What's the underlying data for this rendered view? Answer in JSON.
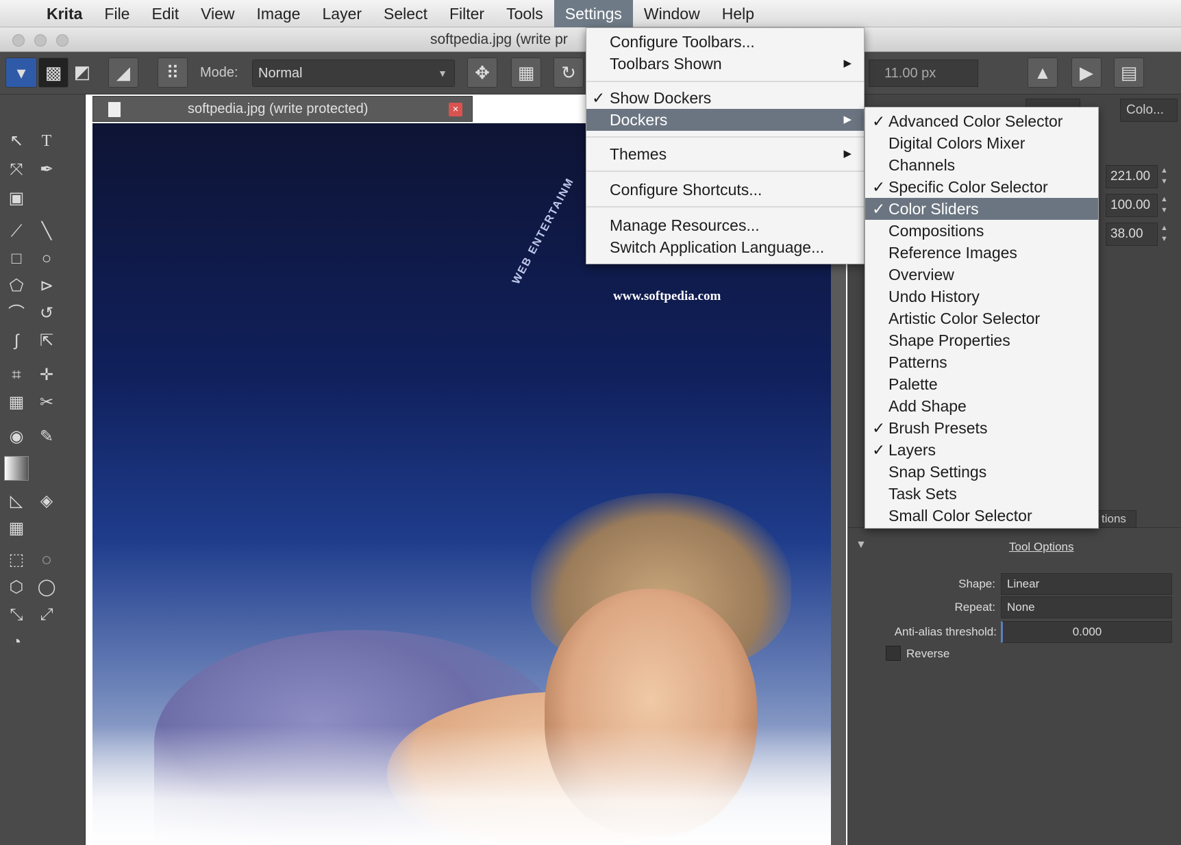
{
  "menubar": {
    "apple": "",
    "items": [
      "Krita",
      "File",
      "Edit",
      "View",
      "Image",
      "Layer",
      "Select",
      "Filter",
      "Tools",
      "Settings",
      "Window",
      "Help"
    ],
    "active": "Settings"
  },
  "window": {
    "title": "softpedia.jpg (write pr"
  },
  "toolbar": {
    "mode_label": "Mode:",
    "mode_value": "Normal",
    "size_value": "11.00 px"
  },
  "document_tab": {
    "label": "softpedia.jpg (write protected)",
    "close": "×"
  },
  "canvas": {
    "url_text": "www.softpedia.com",
    "arc_text": "WEB  ENTERTAINM"
  },
  "right_panel": {
    "tab_label": "Colo...",
    "spin_values": [
      "221.00",
      "100.00",
      "38.00"
    ]
  },
  "tool_options": {
    "tab_label": "tions",
    "title": "Tool Options",
    "shape_label": "Shape:",
    "shape_value": "Linear",
    "repeat_label": "Repeat:",
    "repeat_value": "None",
    "antialias_label": "Anti-alias threshold:",
    "antialias_value": "0.000",
    "reverse_label": "Reverse"
  },
  "settings_menu": {
    "items": [
      {
        "label": "Configure Toolbars...",
        "checked": false,
        "submenu": false
      },
      {
        "label": "Toolbars Shown",
        "checked": false,
        "submenu": true
      },
      {
        "label": "Show Dockers",
        "checked": true,
        "submenu": false
      },
      {
        "label": "Dockers",
        "checked": false,
        "submenu": true,
        "highlighted": true
      },
      {
        "label": "Themes",
        "checked": false,
        "submenu": true
      },
      {
        "label": "Configure Shortcuts...",
        "checked": false,
        "submenu": false
      },
      {
        "label": "Manage Resources...",
        "checked": false,
        "submenu": false
      },
      {
        "label": "Switch Application Language...",
        "checked": false,
        "submenu": false
      }
    ],
    "check_glyph": "✓",
    "submenu_glyph": "▶"
  },
  "dockers_menu": {
    "items": [
      {
        "label": "Advanced Color Selector",
        "checked": true
      },
      {
        "label": "Digital Colors Mixer",
        "checked": false
      },
      {
        "label": "Channels",
        "checked": false
      },
      {
        "label": "Specific Color Selector",
        "checked": true
      },
      {
        "label": "Color Sliders",
        "checked": true,
        "highlighted": true
      },
      {
        "label": "Compositions",
        "checked": false
      },
      {
        "label": "Reference Images",
        "checked": false
      },
      {
        "label": "Overview",
        "checked": false
      },
      {
        "label": "Undo History",
        "checked": false
      },
      {
        "label": "Artistic Color Selector",
        "checked": false
      },
      {
        "label": "Shape Properties",
        "checked": false
      },
      {
        "label": "Patterns",
        "checked": false
      },
      {
        "label": "Palette",
        "checked": false
      },
      {
        "label": "Add Shape",
        "checked": false
      },
      {
        "label": "Brush Presets",
        "checked": true
      },
      {
        "label": "Layers",
        "checked": true
      },
      {
        "label": "Snap Settings",
        "checked": false
      },
      {
        "label": "Task Sets",
        "checked": false
      },
      {
        "label": "Small Color Selector",
        "checked": false
      }
    ]
  },
  "colors": {
    "menu_highlight": "#6b7581",
    "panel_bg": "#444444",
    "canvas_top": "#0e1434",
    "close_red": "#d9534f"
  }
}
